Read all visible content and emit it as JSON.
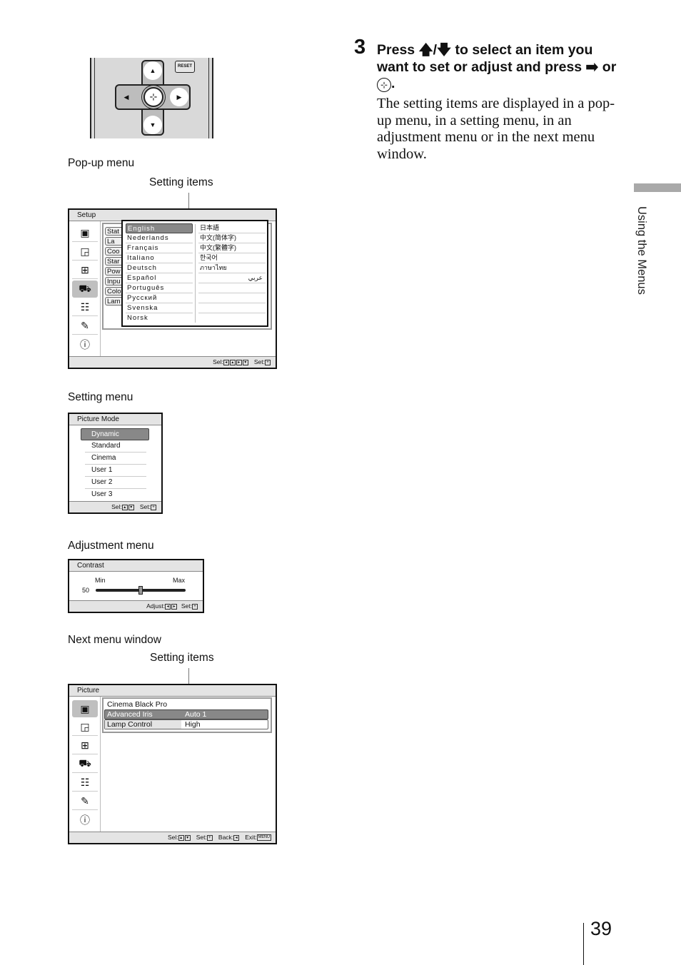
{
  "remote": {
    "reset_label": "RESET",
    "up_icon": "▲",
    "down_icon": "▼",
    "left_icon": "◀",
    "right_icon": "▶",
    "enter_icon": "⊹"
  },
  "captions": {
    "popup": "Pop-up menu",
    "setting": "Setting menu",
    "adjustment": "Adjustment menu",
    "next": "Next menu window",
    "setting_items_1": "Setting items",
    "setting_items_2": "Setting items"
  },
  "popup_menu": {
    "title": "Setup",
    "icons": [
      "picture-icon",
      "advanced-picture-icon",
      "screen-icon",
      "setup-icon",
      "function-icon",
      "installation-icon",
      "information-icon"
    ],
    "icon_glyphs": [
      "▣",
      "▣",
      "⊞",
      "⌂",
      "☷",
      "🔧",
      "ⓘ"
    ],
    "stubs": [
      "Stat",
      "La",
      "Coo",
      "Star",
      "Pow",
      "Inpu",
      "Colo",
      "Lam"
    ],
    "languages_left": [
      "English",
      "Nederlands",
      "Français",
      "Italiano",
      "Deutsch",
      "Español",
      "Português",
      "Русский",
      "Svenska",
      "Norsk"
    ],
    "languages_right": [
      "日本語",
      "中文(简体字)",
      "中文(繁體字)",
      "한국어",
      "ภาษาไทย",
      "عربي"
    ],
    "selected": "English",
    "footer_sel": "Sel:",
    "footer_set": "Set:"
  },
  "setting_menu": {
    "title": "Picture Mode",
    "items": [
      "Dynamic",
      "Standard",
      "Cinema",
      "User 1",
      "User 2",
      "User 3"
    ],
    "selected": "Dynamic",
    "footer_sel": "Sel:",
    "footer_set": "Set:"
  },
  "adjustment_menu": {
    "title": "Contrast",
    "min_label": "Min",
    "max_label": "Max",
    "value": "50",
    "slider_fraction": 0.5,
    "footer_adjust": "Adjust:",
    "footer_set": "Set:"
  },
  "next_menu": {
    "title": "Picture",
    "items": [
      {
        "label": "Cinema Black Pro",
        "value": ""
      },
      {
        "label": "Advanced Iris",
        "value": "Auto 1"
      },
      {
        "label": "Lamp Control",
        "value": "High"
      }
    ],
    "footer_sel": "Sel:",
    "footer_set": "Set:",
    "footer_back": "Back:",
    "footer_exit": "Exit:",
    "menu_key": "MENU"
  },
  "step": {
    "number": "3",
    "heading_part1": "Press ",
    "heading_arrows": "🡅/🡇",
    "heading_part2": " to select an item you want to set or adjust and press ",
    "heading_arrow_right": "➡",
    "heading_or": " or ",
    "heading_enter": "⊹",
    "heading_end": ".",
    "body": "The setting items are displayed in a pop-up menu, in a setting menu, in an adjustment menu or in the next menu window."
  },
  "side_tab": {
    "label": "Using the Menus"
  },
  "page_number": "39"
}
